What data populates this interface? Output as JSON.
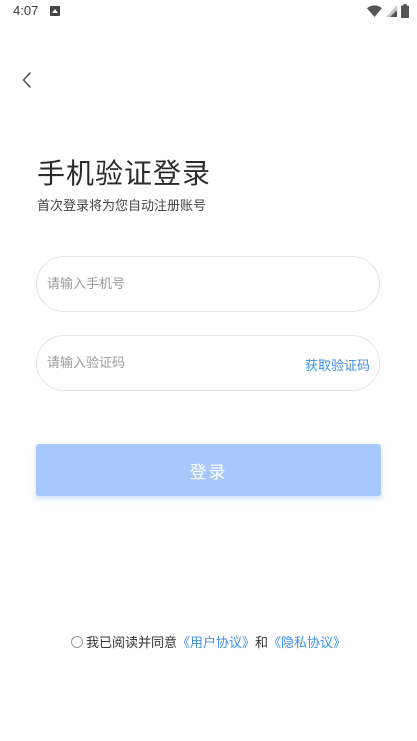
{
  "status_bar": {
    "time": "4:07",
    "icons": [
      "notification-icon",
      "wifi-icon",
      "signal-icon",
      "battery-icon"
    ]
  },
  "header": {
    "title": "手机验证登录",
    "subtitle": "首次登录将为您自动注册账号"
  },
  "form": {
    "phone_placeholder": "请输入手机号",
    "phone_value": "",
    "code_placeholder": "请输入验证码",
    "code_value": "",
    "get_code_label": "获取验证码",
    "login_label": "登录"
  },
  "agreement": {
    "checked": false,
    "prefix": "我已阅读并同意",
    "user_agreement": "《用户协议》",
    "conjunction": "和",
    "privacy_policy": "《隐私协议》"
  },
  "colors": {
    "accent": "#3d8fe8",
    "button_disabled": "#a6c8fb",
    "border": "#e3e3e3"
  }
}
